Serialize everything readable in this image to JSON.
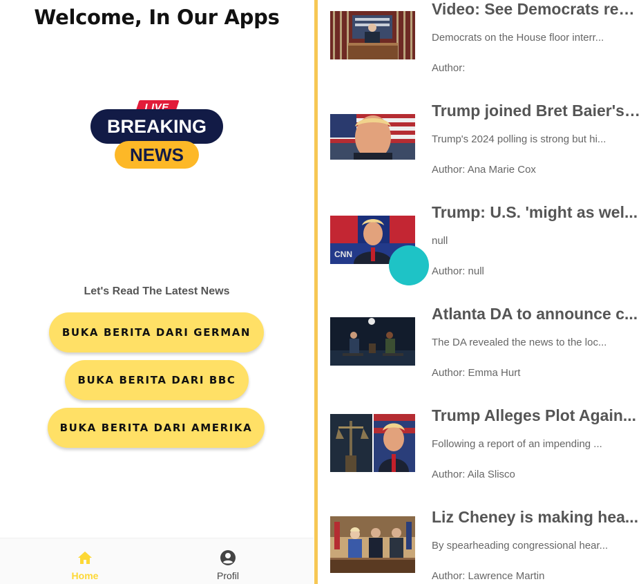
{
  "left": {
    "welcome_title": "Welcome, In Our Apps",
    "logo": {
      "live": "LIVE",
      "breaking": "BREAKING",
      "news": "NEWS"
    },
    "subtitle": "Let's Read The Latest News",
    "buttons": [
      "BUKA BERITA DARI GERMAN",
      "BUKA BERITA DARI BBC",
      "BUKA BERITA DARI AMERIKA"
    ],
    "nav": {
      "home_label": "Home",
      "profil_label": "Profil",
      "active_color": "#fdd835"
    }
  },
  "articles": [
    {
      "title": "Video: See Democrats rep...",
      "description": "Democrats on the House floor interr...",
      "author": "Author:",
      "thumb": "house-chamber-speaker"
    },
    {
      "title": "Trump joined Bret Baier's ...",
      "description": "Trump's 2024 polling is strong but hi...",
      "author": "Author: Ana Marie Cox",
      "thumb": "trump-closeup-flag"
    },
    {
      "title": "Trump: U.S. 'might as wel...",
      "description": "null",
      "author": "Author: null",
      "thumb": "trump-cnn-studio"
    },
    {
      "title": "Atlanta DA to announce c...",
      "description": "The DA revealed the news to the loc...",
      "author": "Author: Emma Hurt",
      "thumb": "interview-stage"
    },
    {
      "title": "Trump Alleges Plot Again...",
      "description": "Following a report of an impending ...",
      "author": "Author: Aila Slisco",
      "thumb": "lady-justice-and-trump"
    },
    {
      "title": "Liz Cheney is making hea...",
      "description": "By spearheading congressional hear...",
      "author": "Author: Lawrence Martin",
      "thumb": "congressional-hearing"
    }
  ],
  "colors": {
    "divider": "#f6c754",
    "button_bg": "#ffe066",
    "touch_indicator": "#1ec3c6"
  }
}
